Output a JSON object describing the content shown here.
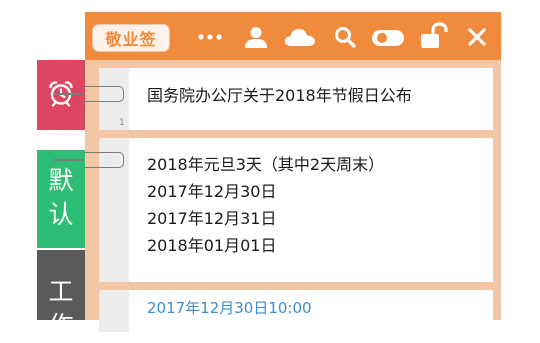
{
  "app": {
    "logo_text": "敬业签",
    "colors": {
      "titlebar": "#f08a3c",
      "panel": "#f3c6a6",
      "alarm_tab": "#dc4660",
      "default_tab": "#2ebd74",
      "work_tab": "#5a5a5a",
      "timestamp": "#3b8fd1"
    }
  },
  "toolbar": {
    "icons": [
      "more-icon",
      "user-icon",
      "cloud-icon",
      "search-icon",
      "toggle-icon",
      "lock-icon",
      "close-icon"
    ]
  },
  "sidebar": {
    "tabs": [
      {
        "name": "alarm",
        "icon": "alarm-clock-icon",
        "chars": []
      },
      {
        "name": "default",
        "chars": [
          "默",
          "认"
        ]
      },
      {
        "name": "work",
        "chars": [
          "工",
          "作"
        ]
      }
    ]
  },
  "notes": [
    {
      "number": "1",
      "lines": [
        "国务院办公厅关于2018年节假日公布"
      ]
    },
    {
      "number": "",
      "lines": [
        "2018年元旦3天（其中2天周末）",
        "2017年12月30日",
        "2017年12月31日",
        "2018年01月01日"
      ]
    },
    {
      "number": "",
      "lines": [
        "2017年12月30日10:00"
      ]
    }
  ]
}
